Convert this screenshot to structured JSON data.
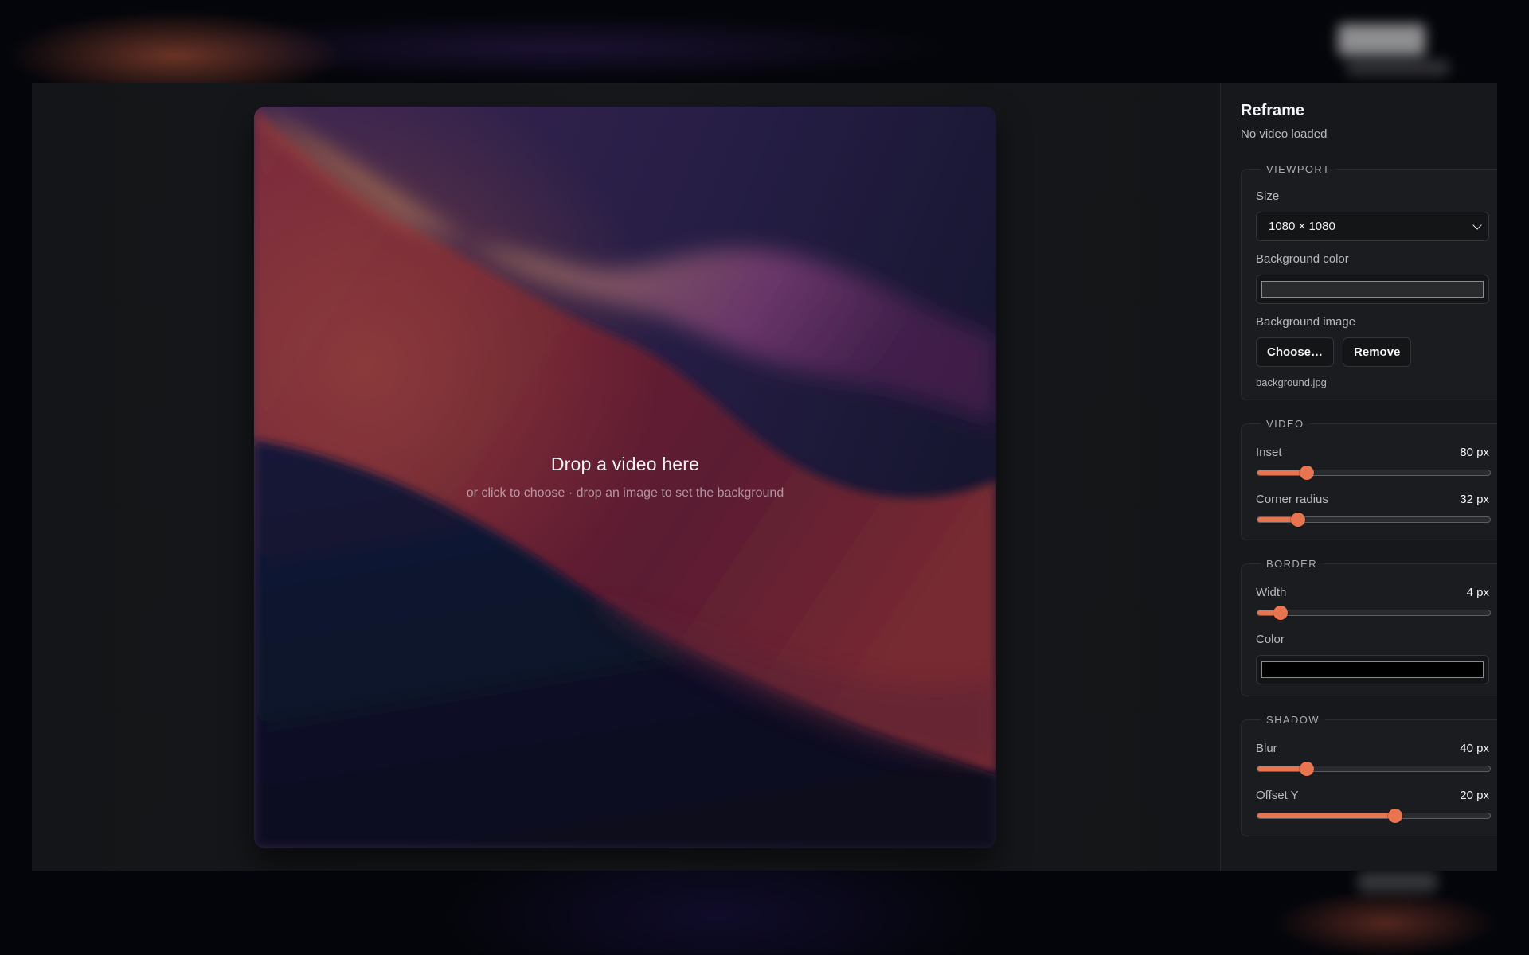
{
  "app": {
    "title": "Reframe",
    "status": "No video loaded"
  },
  "dropzone": {
    "title": "Drop a video here",
    "subtitle": "or click to choose · drop an image to set the background"
  },
  "viewport": {
    "legend": "VIEWPORT",
    "size_label": "Size",
    "size_value": "1080 × 1080",
    "bg_color_label": "Background color",
    "bg_color_value": "#2a2b2d",
    "bg_image_label": "Background image",
    "choose_label": "Choose…",
    "remove_label": "Remove",
    "bg_file_name": "background.jpg"
  },
  "video": {
    "legend": "VIDEO",
    "inset_label": "Inset",
    "inset_value": "80 px",
    "inset_level": 0.2,
    "radius_label": "Corner radius",
    "radius_value": "32 px",
    "radius_level": 0.16
  },
  "border": {
    "legend": "BORDER",
    "width_label": "Width",
    "width_value": "4 px",
    "width_level": 0.08,
    "color_label": "Color",
    "color_value": "#000000"
  },
  "shadow": {
    "legend": "SHADOW",
    "blur_label": "Blur",
    "blur_value": "40 px",
    "blur_level": 0.2,
    "offset_label": "Offset Y",
    "offset_value": "20 px",
    "offset_level": 0.6
  },
  "colors": {
    "accent": "#e8754f",
    "panel_bg": "#17181b"
  },
  "icons": {
    "select_chevron": "chevron-down-icon"
  }
}
